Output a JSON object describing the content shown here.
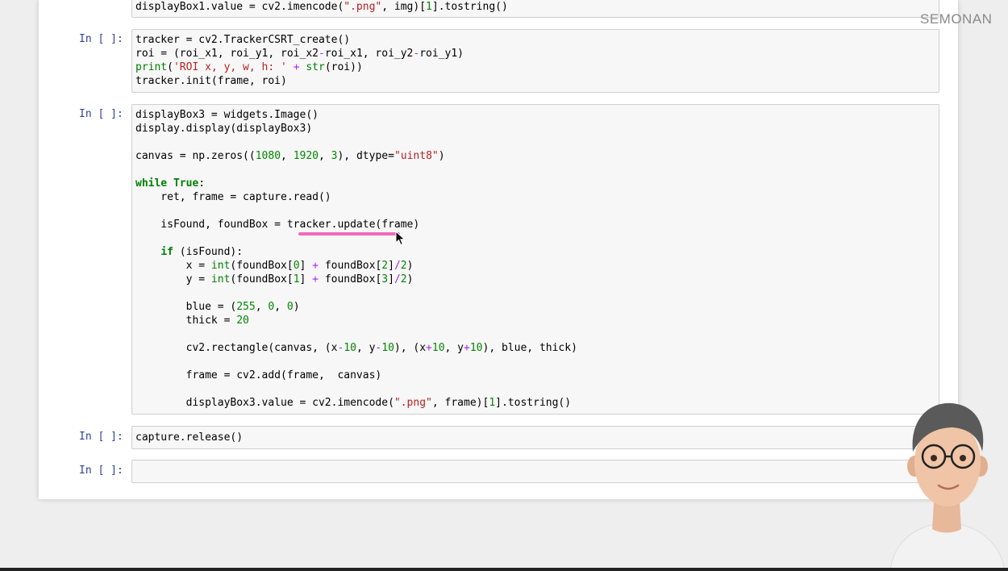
{
  "watermark": "SEMONAN",
  "cells": [
    {
      "prompt": "",
      "lines": [
        [
          [
            "displayBox1.value = cv2.imencode(",
            ""
          ],
          [
            "\".png\"",
            "s"
          ],
          [
            ", img)[",
            ""
          ],
          [
            "1",
            "n"
          ],
          [
            "].tostring()",
            ""
          ]
        ]
      ]
    },
    {
      "prompt": "In [ ]:",
      "lines": [
        [
          [
            "tracker = cv2.TrackerCSRT_create()",
            ""
          ]
        ],
        [
          [
            "roi = (roi_x1, roi_y1, roi_x2",
            ""
          ],
          [
            "-",
            "o"
          ],
          [
            "roi_x1, roi_y2",
            ""
          ],
          [
            "-",
            "o"
          ],
          [
            "roi_y1)",
            ""
          ]
        ],
        [
          [
            "print",
            "b"
          ],
          [
            "(",
            ""
          ],
          [
            "'ROI x, y, w, h: '",
            "s"
          ],
          [
            " ",
            ""
          ],
          [
            "+",
            "o"
          ],
          [
            " ",
            ""
          ],
          [
            "str",
            "b"
          ],
          [
            "(roi))",
            ""
          ]
        ],
        [
          [
            "tracker.init(frame, roi)",
            ""
          ]
        ]
      ]
    },
    {
      "prompt": "In [ ]:",
      "lines": [
        [
          [
            "displayBox3 = widgets.Image()",
            ""
          ]
        ],
        [
          [
            "display.display(displayBox3)",
            ""
          ]
        ],
        [
          [
            "",
            ""
          ]
        ],
        [
          [
            "canvas = np.zeros((",
            ""
          ],
          [
            "1080",
            "n"
          ],
          [
            ", ",
            ""
          ],
          [
            "1920",
            "n"
          ],
          [
            ", ",
            ""
          ],
          [
            "3",
            "n"
          ],
          [
            "), dtype=",
            ""
          ],
          [
            "\"uint8\"",
            "s"
          ],
          [
            ")",
            ""
          ]
        ],
        [
          [
            "",
            ""
          ]
        ],
        [
          [
            "while",
            "k"
          ],
          [
            " ",
            ""
          ],
          [
            "True",
            "k"
          ],
          [
            ":",
            ""
          ]
        ],
        [
          [
            "    ret, frame = capture.read()",
            ""
          ]
        ],
        [
          [
            "",
            ""
          ]
        ],
        [
          [
            "    isFound, foundBox = tracker.update(frame)",
            ""
          ]
        ],
        [
          [
            "",
            ""
          ]
        ],
        [
          [
            "    ",
            ""
          ],
          [
            "if",
            "k"
          ],
          [
            " (isFound):",
            ""
          ]
        ],
        [
          [
            "        x = ",
            ""
          ],
          [
            "int",
            "b"
          ],
          [
            "(foundBox[",
            ""
          ],
          [
            "0",
            "n"
          ],
          [
            "] ",
            ""
          ],
          [
            "+",
            "o"
          ],
          [
            " foundBox[",
            ""
          ],
          [
            "2",
            "n"
          ],
          [
            "]",
            ""
          ],
          [
            "/",
            "o"
          ],
          [
            "2",
            "n"
          ],
          [
            ")",
            ""
          ]
        ],
        [
          [
            "        y = ",
            ""
          ],
          [
            "int",
            "b"
          ],
          [
            "(foundBox[",
            ""
          ],
          [
            "1",
            "n"
          ],
          [
            "] ",
            ""
          ],
          [
            "+",
            "o"
          ],
          [
            " foundBox[",
            ""
          ],
          [
            "3",
            "n"
          ],
          [
            "]",
            ""
          ],
          [
            "/",
            "o"
          ],
          [
            "2",
            "n"
          ],
          [
            ")",
            ""
          ]
        ],
        [
          [
            "",
            ""
          ]
        ],
        [
          [
            "        blue = (",
            ""
          ],
          [
            "255",
            "n"
          ],
          [
            ", ",
            ""
          ],
          [
            "0",
            "n"
          ],
          [
            ", ",
            ""
          ],
          [
            "0",
            "n"
          ],
          [
            ")",
            ""
          ]
        ],
        [
          [
            "        thick = ",
            ""
          ],
          [
            "20",
            "n"
          ]
        ],
        [
          [
            "",
            ""
          ]
        ],
        [
          [
            "        cv2.rectangle(canvas, (x",
            ""
          ],
          [
            "-",
            "o"
          ],
          [
            "10",
            "n"
          ],
          [
            ", y",
            ""
          ],
          [
            "-",
            "o"
          ],
          [
            "10",
            "n"
          ],
          [
            "), (x",
            ""
          ],
          [
            "+",
            "o"
          ],
          [
            "10",
            "n"
          ],
          [
            ", y",
            ""
          ],
          [
            "+",
            "o"
          ],
          [
            "10",
            "n"
          ],
          [
            "), blue, thick)",
            ""
          ]
        ],
        [
          [
            "",
            ""
          ]
        ],
        [
          [
            "        frame = cv2.add(frame,  canvas)",
            ""
          ]
        ],
        [
          [
            "",
            ""
          ]
        ],
        [
          [
            "        displayBox3.value = cv2.imencode(",
            ""
          ],
          [
            "\".png\"",
            "s"
          ],
          [
            ", frame)[",
            ""
          ],
          [
            "1",
            "n"
          ],
          [
            "].tostring()",
            ""
          ]
        ]
      ]
    },
    {
      "prompt": "In [ ]:",
      "lines": [
        [
          [
            "capture.release()",
            ""
          ]
        ]
      ]
    },
    {
      "prompt": "In [ ]:",
      "lines": []
    }
  ],
  "colors": {
    "keyword": "#008000",
    "string": "#ba2121",
    "number": "#008800",
    "operator": "#aa22ff",
    "prompt": "#303f9f",
    "highlight": "#f06bbd"
  }
}
